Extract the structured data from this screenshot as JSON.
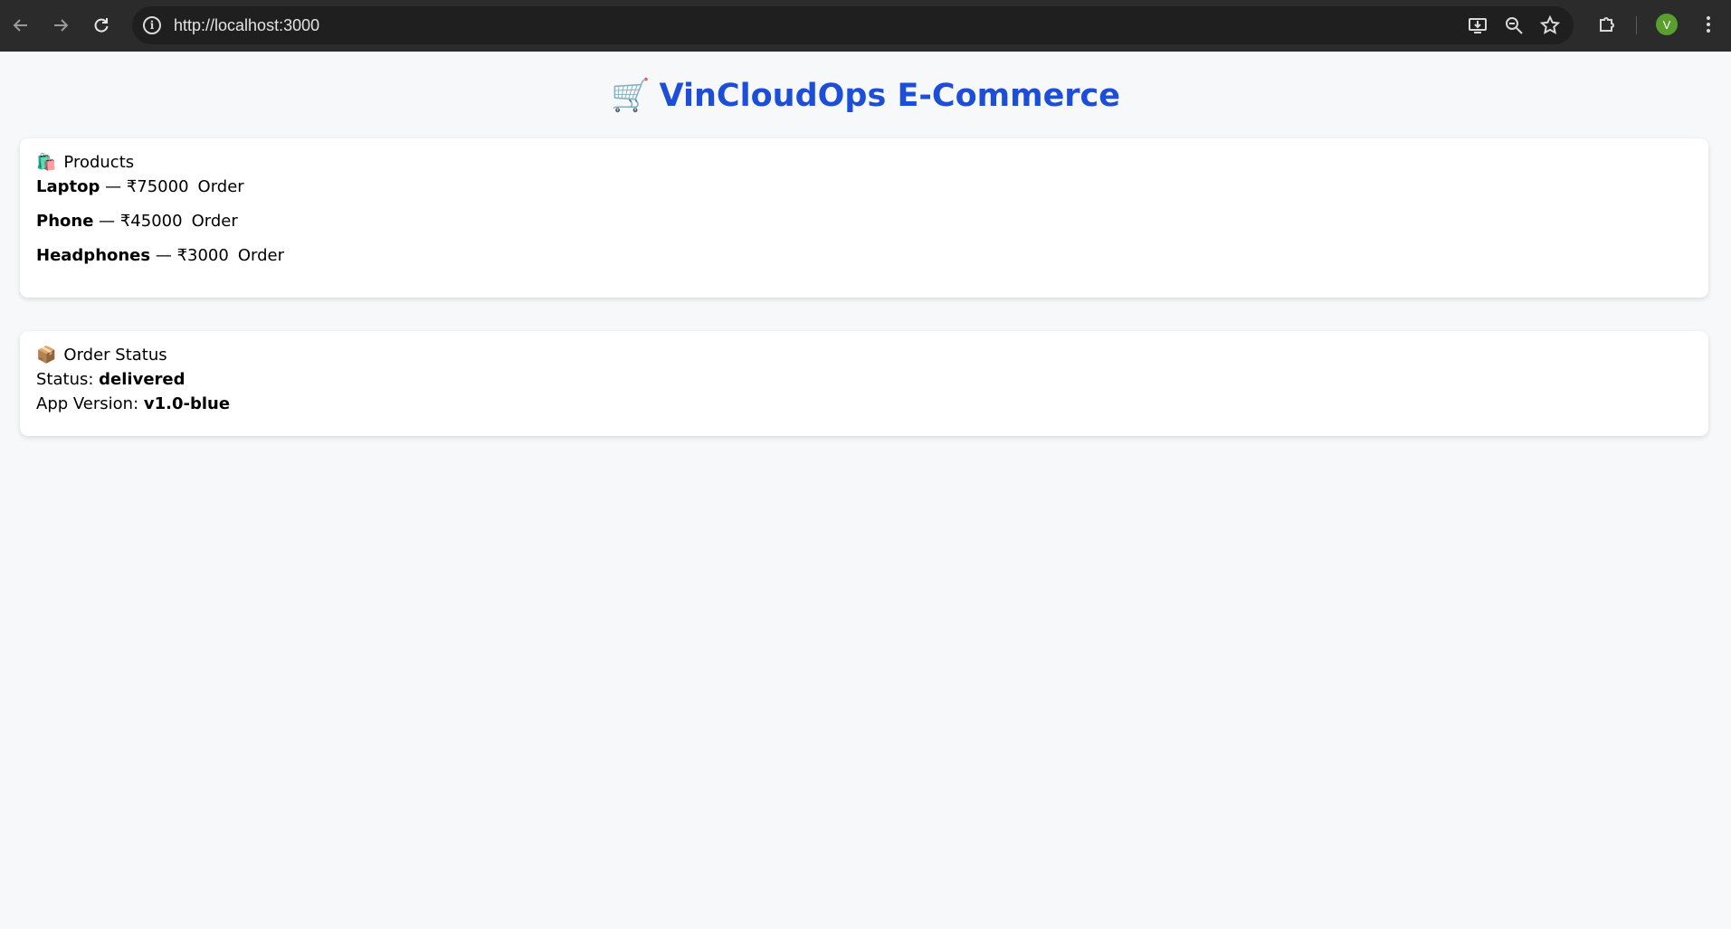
{
  "browser": {
    "url": "http://localhost:3000",
    "profile_initial": "V"
  },
  "page": {
    "title_emoji": "🛒",
    "title": "VinCloudOps E-Commerce"
  },
  "products": {
    "heading_emoji": "🛍️",
    "heading": "Products",
    "items": [
      {
        "name": "Laptop",
        "price": "₹75000",
        "action": "Order"
      },
      {
        "name": "Phone",
        "price": "₹45000",
        "action": "Order"
      },
      {
        "name": "Headphones",
        "price": "₹3000",
        "action": "Order"
      }
    ],
    "separator": " — "
  },
  "order_status": {
    "heading_emoji": "📦",
    "heading": "Order Status",
    "status_label": "Status: ",
    "status_value": "delivered",
    "version_label": "App Version: ",
    "version_value": "v1.0-blue"
  }
}
